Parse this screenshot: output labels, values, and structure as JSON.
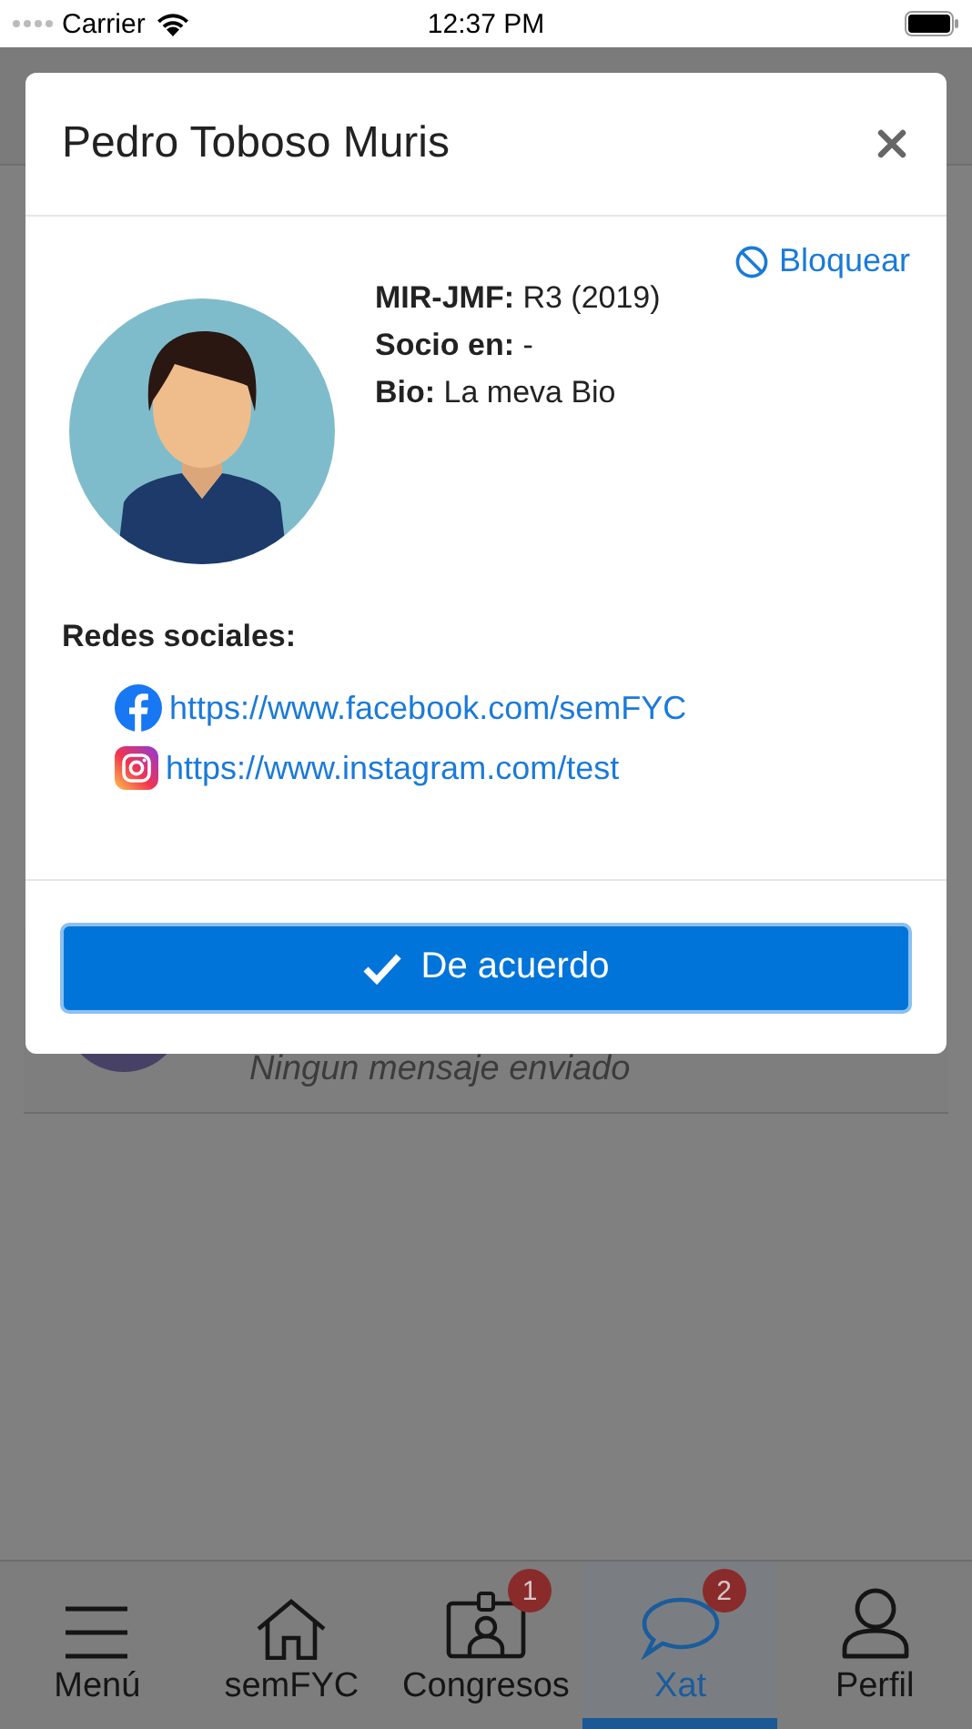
{
  "status_bar": {
    "carrier": "Carrier",
    "time": "12:37 PM"
  },
  "background": {
    "message": "Ningun mensaje enviado"
  },
  "modal": {
    "title": "Pedro Toboso Muris",
    "block_link": "Bloquear",
    "fields": [
      "**MIR-JMF:** R3 (2019)",
      "**Socio en:** -",
      "**Bio:** La meva Bio"
    ],
    "social_heading": "Redes sociales:",
    "social_links": [
      {
        "kind": "facebook",
        "url": "https://www.facebook.com/semFYC"
      },
      {
        "kind": "instagram",
        "url": "https://www.instagram.com/test"
      }
    ],
    "confirm_button": "De acuerdo"
  },
  "tab_bar": [
    {
      "kind": "menu",
      "label": "Menú",
      "selected": false
    },
    {
      "kind": "home",
      "label": "semFYC",
      "selected": false
    },
    {
      "kind": "badge",
      "label": "Congresos",
      "selected": false,
      "badge": "1"
    },
    {
      "kind": "chat",
      "label": "Xat",
      "selected": true,
      "badge": "2"
    },
    {
      "kind": "person",
      "label": "Perfil",
      "selected": false
    }
  ]
}
